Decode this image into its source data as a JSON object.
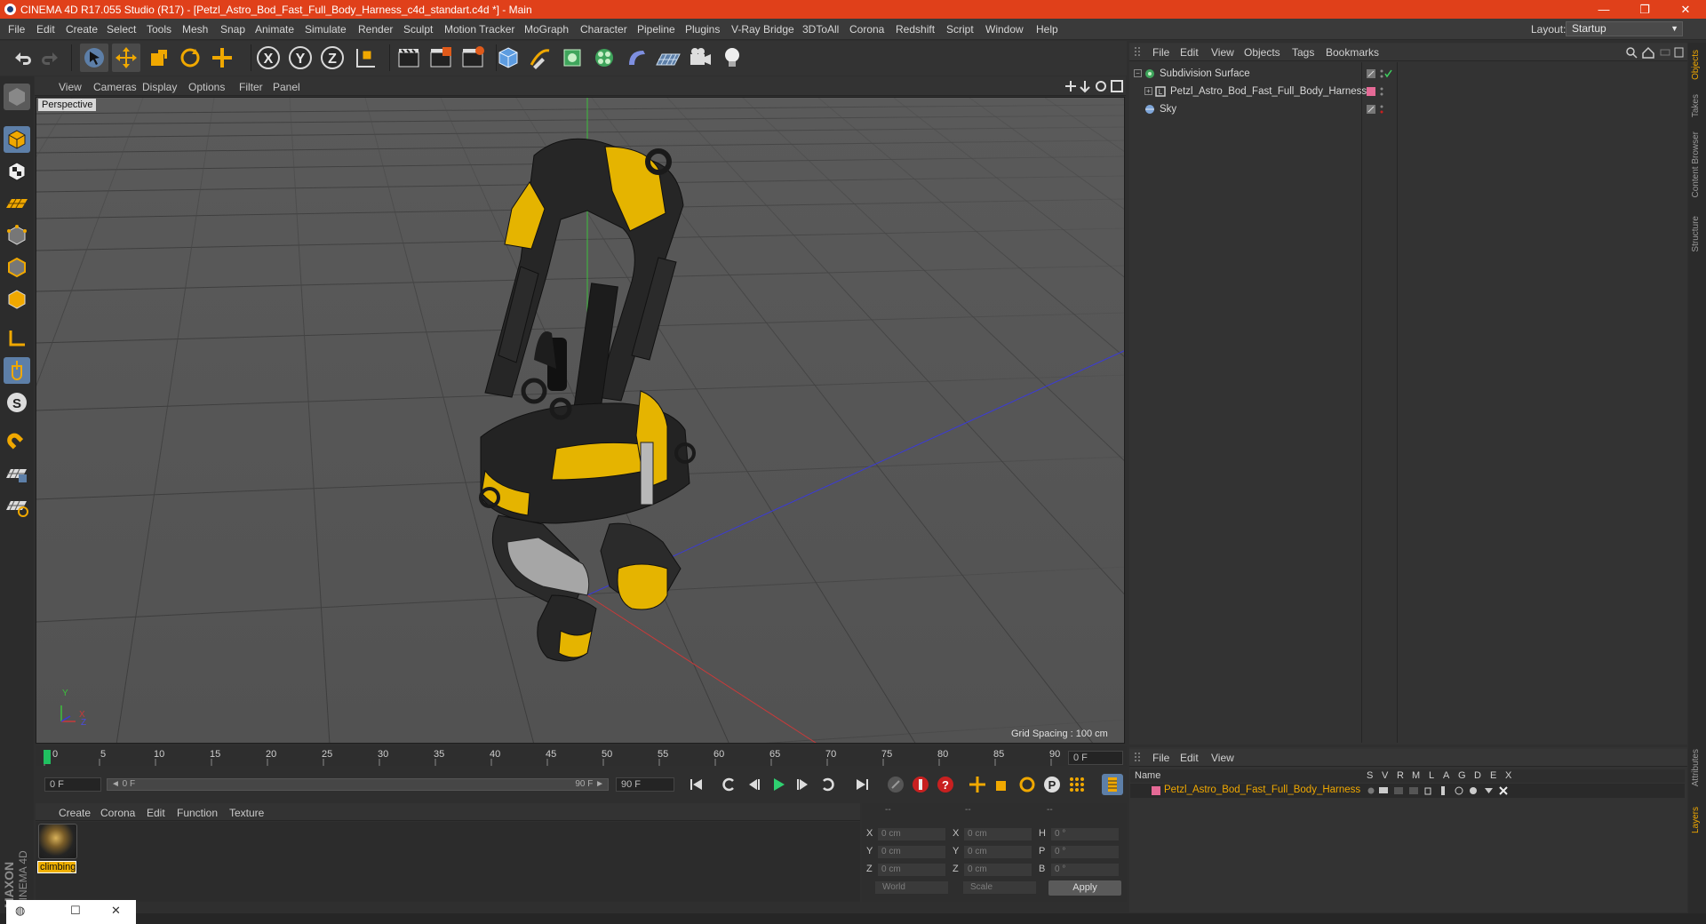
{
  "app": {
    "title": "CINEMA 4D R17.055 Studio (R17) - [Petzl_Astro_Bod_Fast_Full_Body_Harness_c4d_standart.c4d *] - Main",
    "brand_color": "#e0401a"
  },
  "window_controls": {
    "minimize": "—",
    "restore": "❐",
    "close": "✕"
  },
  "menubar": {
    "items": [
      "File",
      "Edit",
      "Create",
      "Select",
      "Tools",
      "Mesh",
      "Snap",
      "Animate",
      "Simulate",
      "Render",
      "Sculpt",
      "Motion Tracker",
      "MoGraph",
      "Character",
      "Pipeline",
      "Plugins",
      "V-Ray Bridge",
      "3DToAll",
      "Corona",
      "Redshift",
      "Script",
      "Window",
      "Help"
    ],
    "layout_label": "Layout:",
    "layout_value": "Startup"
  },
  "toolbar": {
    "icons": [
      "undo-icon",
      "redo-icon",
      "live-selection-icon",
      "move-icon",
      "scale-icon",
      "rotate-icon",
      "add-icon",
      "x-axis-icon",
      "y-axis-icon",
      "z-axis-icon",
      "coordinate-system-icon",
      "render-view-icon",
      "render-picture-viewer-icon",
      "edit-render-settings-icon",
      "cube-icon",
      "pen-icon",
      "subdivision-icon",
      "cloner-icon",
      "deformer-icon",
      "floor-icon",
      "camera-icon",
      "light-icon"
    ]
  },
  "left_palette": {
    "icons": [
      "make-editable-icon",
      "model-mode-icon",
      "texture-mode-icon",
      "workplane-icon",
      "points-mode-icon",
      "edges-mode-icon",
      "polygons-mode-icon",
      "axis-icon",
      "tweak-icon",
      "snap-icon",
      "magnet-icon",
      "lock-workplane-icon",
      "planar-workplane-icon"
    ]
  },
  "viewport": {
    "menu": [
      "View",
      "Cameras",
      "Display",
      "Options",
      "Filter",
      "Panel"
    ],
    "camera_label": "Perspective",
    "grid_spacing": "Grid Spacing : 100 cm",
    "axis_labels": {
      "y": "Y",
      "x": "X",
      "z": "Z"
    }
  },
  "timeline": {
    "ticks": [
      "0",
      "5",
      "10",
      "15",
      "20",
      "25",
      "30",
      "35",
      "40",
      "45",
      "50",
      "55",
      "60",
      "65",
      "70",
      "75",
      "80",
      "85",
      "90"
    ],
    "current_frame": "0 F",
    "start_frame": "0 F",
    "scrub_start": "◄ 0 F",
    "scrub_end": "90 F ►",
    "end_frame": "90 F",
    "max_frame": "90 F"
  },
  "materials": {
    "menu": [
      "Create",
      "Corona",
      "Edit",
      "Function",
      "Texture"
    ],
    "items": [
      {
        "name": "climbing"
      }
    ]
  },
  "coordinates": {
    "header": [
      "--",
      "--",
      "--"
    ],
    "rows": [
      {
        "pos_axis": "X",
        "pos": "0 cm",
        "size_axis": "X",
        "size": "0 cm",
        "rot_axis": "H",
        "rot": "0 °"
      },
      {
        "pos_axis": "Y",
        "pos": "0 cm",
        "size_axis": "Y",
        "size": "0 cm",
        "rot_axis": "P",
        "rot": "0 °"
      },
      {
        "pos_axis": "Z",
        "pos": "0 cm",
        "size_axis": "Z",
        "size": "0 cm",
        "rot_axis": "B",
        "rot": "0 °"
      }
    ],
    "space": "World",
    "mode": "Scale",
    "apply_label": "Apply"
  },
  "object_manager": {
    "menu": [
      "File",
      "Edit",
      "View",
      "Objects",
      "Tags",
      "Bookmarks"
    ],
    "objects": [
      {
        "name": "Subdivision Surface",
        "icon": "subdivision-surface-icon"
      },
      {
        "name": "Petzl_Astro_Bod_Fast_Full_Body_Harness",
        "icon": "null-object-icon"
      },
      {
        "name": "Sky",
        "icon": "sky-icon"
      }
    ]
  },
  "right_tabs": [
    "Objects",
    "Takes",
    "Content Browser",
    "Structure",
    "Attributes",
    "Layers"
  ],
  "layer_manager": {
    "menu": [
      "File",
      "Edit",
      "View"
    ],
    "columns": [
      "Name",
      "S",
      "V",
      "R",
      "M",
      "L",
      "A",
      "G",
      "D",
      "E",
      "X"
    ],
    "layers": [
      {
        "name": "Petzl_Astro_Bod_Fast_Full_Body_Harness",
        "color": "#e56a96"
      }
    ]
  },
  "maxon": {
    "line1": "MAXON",
    "line2": "CINEMA 4D"
  }
}
